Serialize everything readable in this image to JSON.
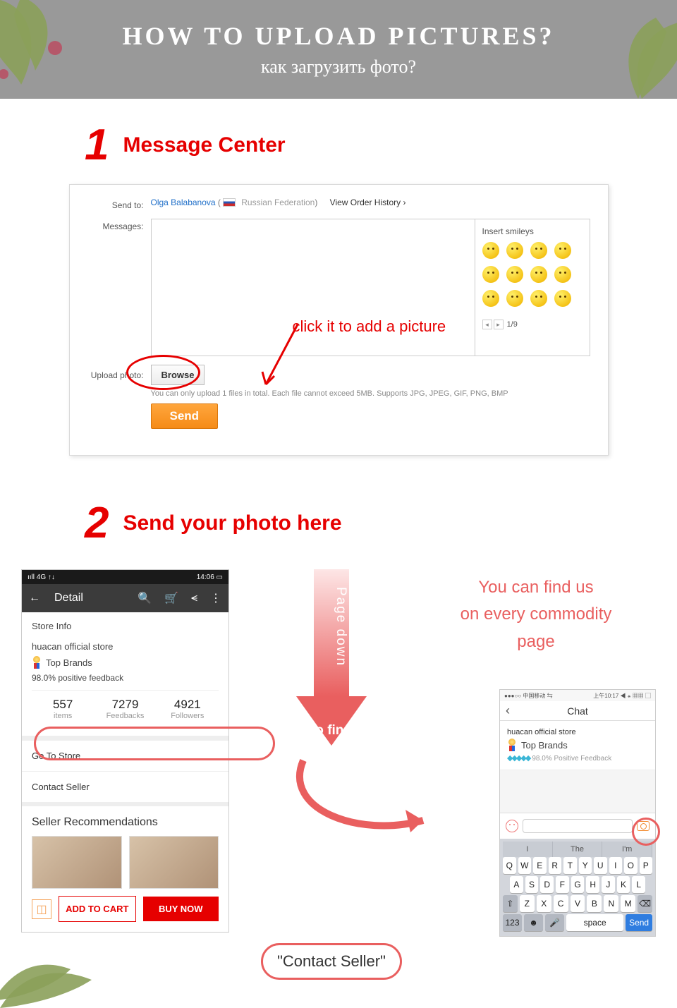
{
  "banner": {
    "title": "HOW TO UPLOAD PICTURES?",
    "subtitle": "как загрузить фото?"
  },
  "step1": {
    "num": "1",
    "title": "Message Center"
  },
  "mc": {
    "sendto_label": "Send to:",
    "recipient": "Olga Balabanova",
    "country": "Russian Federation",
    "view_order": "View Order History",
    "messages_label": "Messages:",
    "smileys_title": "Insert smileys",
    "pager": "1/9",
    "upload_label": "Upload photo:",
    "browse": "Browse",
    "hint": "You can only upload 1 files in total. Each file cannot exceed 5MB. Supports JPG, JPEG, GIF, PNG, BMP",
    "send": "Send",
    "anno_click": "click it to add a picture"
  },
  "step2": {
    "num": "2",
    "title": "Send your photo here"
  },
  "phone1": {
    "status_left": "ııll  4G ↑↓",
    "status_right": "14:06",
    "bar_title": "Detail",
    "store_info": "Store Info",
    "store": "huacan official store",
    "top_brands": "Top Brands",
    "feedback": "98.0% positive feedback",
    "stats": [
      {
        "n": "557",
        "l": "items"
      },
      {
        "n": "7279",
        "l": "Feedbacks"
      },
      {
        "n": "4921",
        "l": "Followers"
      }
    ],
    "goto": "Go To Store",
    "contact": "Contact Seller",
    "rec_title": "Seller Recommendations",
    "add_cart": "ADD TO CART",
    "buy_now": "BUY NOW"
  },
  "mid": {
    "page_down": "Page down",
    "to_find": "to find",
    "contact_seller": "\"Contact Seller\"",
    "find_us_1": "You can find us",
    "find_us_2": "on every commodity page"
  },
  "phone2": {
    "status_l": "●●●○○ 中国移动 ⇆",
    "status_r": "上午10:17   ◀ ⚹ ▦▦ ▢",
    "chat": "Chat",
    "store": "huacan official store",
    "top_brands": "Top Brands",
    "feedback": "98.0% Positive Feedback",
    "sugg": [
      "I",
      "The",
      "I'm"
    ],
    "rows": [
      [
        "Q",
        "W",
        "E",
        "R",
        "T",
        "Y",
        "U",
        "I",
        "O",
        "P"
      ],
      [
        "A",
        "S",
        "D",
        "F",
        "G",
        "H",
        "J",
        "K",
        "L"
      ],
      [
        "⇧",
        "Z",
        "X",
        "C",
        "V",
        "B",
        "N",
        "M",
        "⌫"
      ]
    ],
    "bottom": {
      "num": "123",
      "emoji": "☻",
      "mic": "🎤",
      "space": "space",
      "send": "Send"
    }
  }
}
